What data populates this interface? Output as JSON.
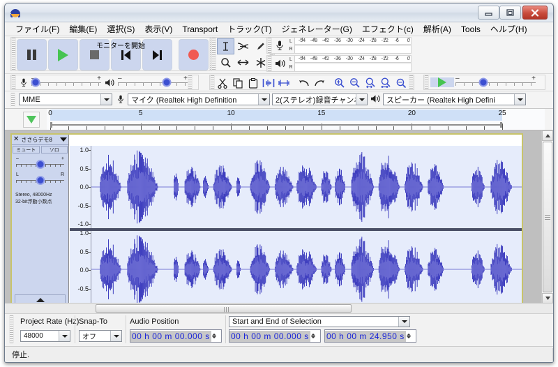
{
  "window": {
    "title": "",
    "controls": {
      "minimize": "minimize-button",
      "maximize": "maximize-button",
      "close": "close-button"
    }
  },
  "menubar": {
    "items": [
      {
        "label": "ファイル(F)"
      },
      {
        "label": "編集(E)"
      },
      {
        "label": "選択(S)"
      },
      {
        "label": "表示(V)"
      },
      {
        "label": "Transport"
      },
      {
        "label": "トラック(T)"
      },
      {
        "label": "ジェネレーター(G)"
      },
      {
        "label": "エフェクト(c)"
      },
      {
        "label": "解析(A)"
      },
      {
        "label": "Tools"
      },
      {
        "label": "ヘルプ(H)"
      }
    ]
  },
  "transport": {
    "buttons": [
      {
        "name": "pause-button",
        "label": "Pause"
      },
      {
        "name": "play-button",
        "label": "Play"
      },
      {
        "name": "stop-button",
        "label": "Stop"
      },
      {
        "name": "skip-to-start-button",
        "label": "Skip to Start"
      },
      {
        "name": "skip-to-end-button",
        "label": "Skip to End"
      },
      {
        "name": "record-button",
        "label": "Record"
      }
    ]
  },
  "tools": {
    "buttons": [
      {
        "name": "selection-tool",
        "label": "Selection Tool",
        "selected": true
      },
      {
        "name": "envelope-tool",
        "label": "Envelope Tool",
        "selected": false
      },
      {
        "name": "draw-tool",
        "label": "Draw Tool",
        "selected": false
      },
      {
        "name": "zoom-tool",
        "label": "Zoom Tool",
        "selected": false
      },
      {
        "name": "time-shift-tool",
        "label": "Time Shift Tool",
        "selected": false
      },
      {
        "name": "multi-tool",
        "label": "Multi Tool",
        "selected": false
      }
    ]
  },
  "meters": {
    "record": {
      "icon": "microphone-icon",
      "channels": [
        "L",
        "R"
      ],
      "ticks": [
        "-54",
        "-48",
        "-42",
        "-36",
        "-30",
        "-24",
        "-18",
        "-12",
        "-6",
        "0"
      ]
    },
    "play": {
      "icon": "speaker-icon",
      "channels": [
        "L",
        "R"
      ],
      "ticks": [
        "-54",
        "-48",
        "-42",
        "-36",
        "-30",
        "-24",
        "-18",
        "-12",
        "-6",
        "0"
      ]
    },
    "tooltip": "モニターを開始"
  },
  "mixer": {
    "input": {
      "icon": "microphone-icon",
      "minus": "–",
      "plus": "+",
      "value_pct": 6
    },
    "output": {
      "icon": "speaker-icon",
      "minus": "–",
      "plus": "+",
      "value_pct": 70
    }
  },
  "edit_toolbar": {
    "buttons": [
      {
        "name": "cut-button",
        "label": "Cut"
      },
      {
        "name": "copy-button",
        "label": "Copy"
      },
      {
        "name": "paste-button",
        "label": "Paste"
      },
      {
        "name": "trim-audio-button",
        "label": "Trim Audio"
      },
      {
        "name": "silence-audio-button",
        "label": "Silence Audio"
      },
      {
        "name": "undo-button",
        "label": "Undo"
      },
      {
        "name": "redo-button",
        "label": "Redo"
      },
      {
        "name": "zoom-in-button",
        "label": "Zoom In"
      },
      {
        "name": "zoom-out-button",
        "label": "Zoom Out"
      },
      {
        "name": "fit-selection-button",
        "label": "Fit Selection"
      },
      {
        "name": "fit-project-button",
        "label": "Fit Project"
      },
      {
        "name": "zoom-toggle-button",
        "label": "Zoom Toggle"
      }
    ]
  },
  "play_speed": {
    "play_label": "Play-at-Speed",
    "minus": "–",
    "plus": "+",
    "value_pct": 35
  },
  "device_toolbar": {
    "host": {
      "value": "MME"
    },
    "input_device": {
      "icon": "microphone-icon",
      "value": "マイク (Realtek High Definition"
    },
    "input_channels": {
      "value": "2(ステレオ)録音チャンネ"
    },
    "output_device": {
      "icon": "speaker-icon",
      "value": "スピーカー (Realtek High Defini"
    }
  },
  "timeline": {
    "pin_icon": "pinned-play-head-icon",
    "ticks": [
      "0",
      "5",
      "10",
      "15",
      "20",
      "25"
    ],
    "unit": "seconds",
    "selection_start": 0,
    "selection_end": 24.95
  },
  "track": {
    "close_label": "✕",
    "name": "ささらデモ8",
    "menu_icon": "chevron-down-icon",
    "mute_label": "ミュート",
    "solo_label": "ソロ",
    "gain": {
      "minus": "–",
      "plus": "+",
      "value_pct": 50
    },
    "pan": {
      "left": "L",
      "right": "R",
      "value_pct": 50
    },
    "info_line1": "Stereo, 48000Hz",
    "info_line2": "32-bit浮動小数点",
    "collapse_icon": "collapse-up-icon",
    "vertical_ruler": [
      "1.0",
      "0.5",
      "0.0",
      "-0.5",
      "-1.0"
    ]
  },
  "selection_toolbar": {
    "project_rate_label": "Project Rate (Hz)",
    "project_rate_value": "48000",
    "snap_to_label": "Snap-To",
    "snap_to_value": "オフ",
    "audio_position_label": "Audio Position",
    "audio_position_value": "00 h 00 m 00.000 s",
    "selection_mode_label": "Start and End of Selection",
    "selection_start_value": "00 h 00 m 00.000 s",
    "selection_end_value": "00 h 00 m 24.950 s"
  },
  "statusbar": {
    "message": "停止."
  },
  "colors": {
    "waveform": "#3c3cbe",
    "waveform_rms": "#6a6ad2",
    "track_selected_bg": "#e6ecfb",
    "track_panel_bg": "#ccd6ee",
    "track_border": "#c8c46a",
    "record_red": "#f05a52",
    "play_green": "#46c451",
    "timeline_selection": "#cfe0f7",
    "time_digits": "#1a24d8"
  }
}
